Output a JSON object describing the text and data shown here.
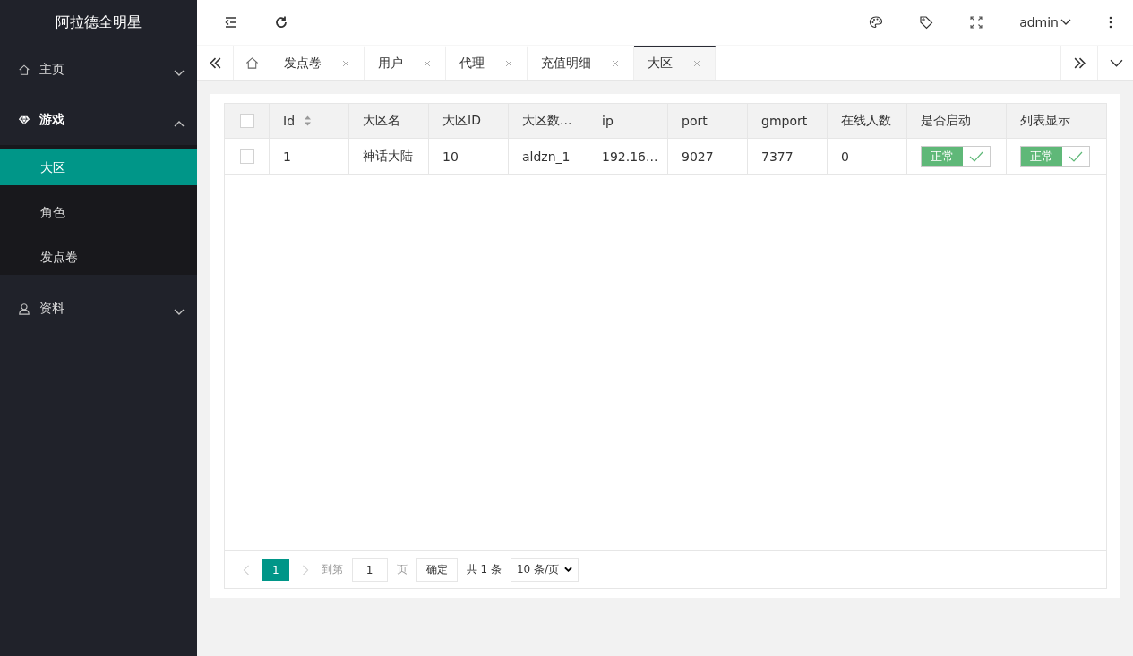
{
  "sidebar": {
    "logo": "阿拉德全明星",
    "items": [
      {
        "label": "主页",
        "expanded": false
      },
      {
        "label": "游戏",
        "expanded": true,
        "children": [
          {
            "label": "大区",
            "selected": true
          },
          {
            "label": "角色",
            "selected": false
          },
          {
            "label": "发点卷",
            "selected": false
          }
        ]
      },
      {
        "label": "资料",
        "expanded": false
      }
    ]
  },
  "header": {
    "user": "admin"
  },
  "tabs": [
    {
      "label": "发点卷",
      "selected": false
    },
    {
      "label": "用户",
      "selected": false
    },
    {
      "label": "代理",
      "selected": false
    },
    {
      "label": "充值明细",
      "selected": false
    },
    {
      "label": "大区",
      "selected": true
    }
  ],
  "table": {
    "select_all_checked": false,
    "columns": [
      {
        "label": "Id"
      },
      {
        "label": "大区名"
      },
      {
        "label": "大区ID"
      },
      {
        "label": "大区数..."
      },
      {
        "label": "ip"
      },
      {
        "label": "port"
      },
      {
        "label": "gmport"
      },
      {
        "label": "在线人数"
      },
      {
        "label": "是否启动"
      },
      {
        "label": "列表显示"
      }
    ],
    "rows": [
      {
        "checked": false,
        "cells": [
          "1",
          "神话大陆",
          "10",
          "aldzn_1",
          "192.16...",
          "9027",
          "7377",
          "0"
        ],
        "switches": [
          {
            "label": "正常",
            "on": true
          },
          {
            "label": "正常",
            "on": true
          }
        ]
      }
    ]
  },
  "pagination": {
    "pages": [
      {
        "label": "1",
        "selected": true
      }
    ],
    "goto_label": "到第",
    "page_input": "1",
    "page_unit": "页",
    "confirm": "确定",
    "total": "共 1 条",
    "page_size": "10 条/页"
  }
}
